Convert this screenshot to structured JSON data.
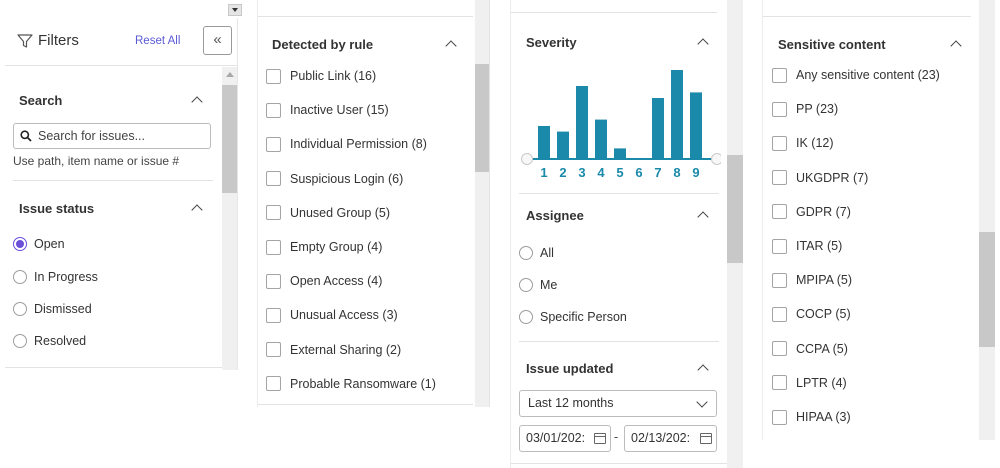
{
  "filters_panel": {
    "title": "Filters",
    "reset_label": "Reset All",
    "collapse_icon": "double-chevron-left",
    "search": {
      "heading": "Search",
      "placeholder": "Search for issues...",
      "hint": "Use path, item name or issue #"
    },
    "issue_status": {
      "heading": "Issue status",
      "options": [
        "Open",
        "In Progress",
        "Dismissed",
        "Resolved"
      ],
      "selected": "Open"
    }
  },
  "detected_by_rule": {
    "heading": "Detected by rule",
    "items": [
      "Public Link (16)",
      "Inactive User (15)",
      "Individual Permission (8)",
      "Suspicious Login (6)",
      "Unused Group (5)",
      "Empty Group (4)",
      "Open Access (4)",
      "Unusual Access (3)",
      "External Sharing (2)",
      "Probable Ransomware (1)"
    ]
  },
  "severity": {
    "heading": "Severity",
    "accent_color": "#1b8aaa",
    "chart_data": {
      "type": "bar",
      "categories": [
        "1",
        "2",
        "3",
        "4",
        "5",
        "6",
        "7",
        "8",
        "9"
      ],
      "values": [
        4,
        3.3,
        9,
        4.8,
        1.2,
        0,
        7.5,
        11,
        8.2
      ],
      "title": "",
      "xlabel": "",
      "ylabel": ""
    }
  },
  "assignee": {
    "heading": "Assignee",
    "options": [
      "All",
      "Me",
      "Specific Person"
    ]
  },
  "issue_updated": {
    "heading": "Issue updated",
    "range_value": "Last 12 months",
    "date_from": "03/01/202:",
    "date_separator": "-",
    "date_to": "02/13/202:"
  },
  "sensitive_content": {
    "heading": "Sensitive content",
    "items": [
      "Any sensitive content (23)",
      "PP (23)",
      "IK (12)",
      "UKGDPR (7)",
      "GDPR (7)",
      "ITAR (5)",
      "MPIPA (5)",
      "COCP (5)",
      "CCPA (5)",
      "LPTR (4)",
      "HIPAA (3)"
    ]
  }
}
